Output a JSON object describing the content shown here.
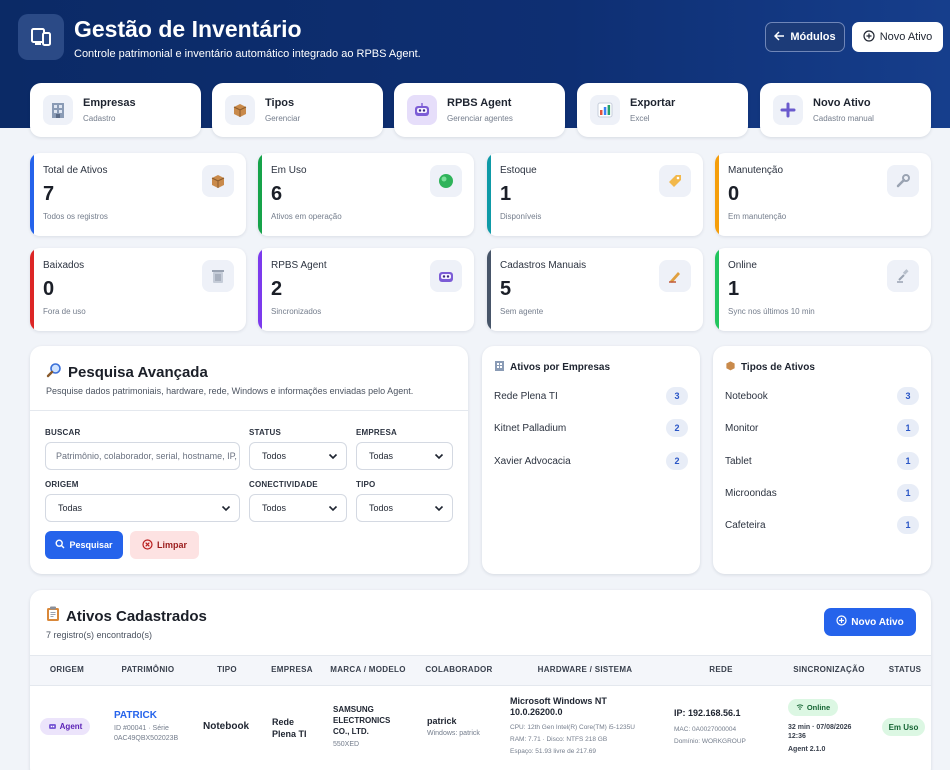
{
  "header": {
    "title": "Gestão de Inventário",
    "subtitle": "Controle patrimonial e inventário automático integrado ao RPBS Agent.",
    "modules_label": "Módulos",
    "new_asset_label": "Novo Ativo"
  },
  "quick_links": [
    {
      "title": "Empresas",
      "sub": "Cadastro",
      "icon": "building-icon"
    },
    {
      "title": "Tipos",
      "sub": "Gerenciar",
      "icon": "box-icon"
    },
    {
      "title": "RPBS Agent",
      "sub": "Gerenciar agentes",
      "icon": "robot-icon"
    },
    {
      "title": "Exportar",
      "sub": "Excel",
      "icon": "chart-icon"
    },
    {
      "title": "Novo Ativo",
      "sub": "Cadastro manual",
      "icon": "plus-icon"
    }
  ],
  "stats": [
    {
      "label": "Total de Ativos",
      "value": "7",
      "sub": "Todos os registros",
      "color": "#2563eb"
    },
    {
      "label": "Em Uso",
      "value": "6",
      "sub": "Ativos em operação",
      "color": "#16a34a"
    },
    {
      "label": "Estoque",
      "value": "1",
      "sub": "Disponíveis",
      "color": "#0e9aa7"
    },
    {
      "label": "Manutenção",
      "value": "0",
      "sub": "Em manutenção",
      "color": "#f59e0b"
    },
    {
      "label": "Baixados",
      "value": "0",
      "sub": "Fora de uso",
      "color": "#dc2626"
    },
    {
      "label": "RPBS Agent",
      "value": "2",
      "sub": "Sincronizados",
      "color": "#7c3aed"
    },
    {
      "label": "Cadastros Manuais",
      "value": "5",
      "sub": "Sem agente",
      "color": "#475569"
    },
    {
      "label": "Online",
      "value": "1",
      "sub": "Sync nos últimos 10 min",
      "color": "#22c55e"
    }
  ],
  "search": {
    "title": "Pesquisa Avançada",
    "description": "Pesquise dados patrimoniais, hardware, rede, Windows e informações enviadas pelo Agent.",
    "buscar_label": "BUSCAR",
    "buscar_placeholder": "Patrimônio, colaborador, serial, hostname, IP,",
    "status_label": "STATUS",
    "status_value": "Todos",
    "empresa_label": "EMPRESA",
    "empresa_value": "Todas",
    "origem_label": "ORIGEM",
    "origem_value": "Todas",
    "conectividade_label": "CONECTIVIDADE",
    "conectividade_value": "Todos",
    "tipo_label": "TIPO",
    "tipo_value": "Todos",
    "search_button": "Pesquisar",
    "clear_button": "Limpar"
  },
  "companies": {
    "title": "Ativos por Empresas",
    "items": [
      {
        "name": "Rede Plena TI",
        "count": "3"
      },
      {
        "name": "Kitnet Palladium",
        "count": "2"
      },
      {
        "name": "Xavier Advocacia",
        "count": "2"
      }
    ]
  },
  "types": {
    "title": "Tipos de Ativos",
    "items": [
      {
        "name": "Notebook",
        "count": "3"
      },
      {
        "name": "Monitor",
        "count": "1"
      },
      {
        "name": "Tablet",
        "count": "1"
      },
      {
        "name": "Microondas",
        "count": "1"
      },
      {
        "name": "Cafeteira",
        "count": "1"
      }
    ]
  },
  "assets": {
    "title": "Ativos Cadastrados",
    "count_text": "7 registro(s) encontrado(s)",
    "new_button": "Novo Ativo",
    "columns": [
      "ORIGEM",
      "PATRIMÔNIO",
      "TIPO",
      "EMPRESA",
      "MARCA / MODELO",
      "COLABORADOR",
      "HARDWARE / SISTEMA",
      "REDE",
      "SINCRONIZAÇÃO",
      "STATUS"
    ],
    "rows": [
      {
        "origem": "Agent",
        "patrimonio": "PATRICK",
        "patrimonio_id": "ID #00041 · Série",
        "patrimonio_serial": "0AC49QBX502023B",
        "tipo": "Notebook",
        "empresa_1": "Rede",
        "empresa_2": "Plena TI",
        "marca_1": "SAMSUNG",
        "marca_2": "ELECTRONICS",
        "marca_3": "CO., LTD.",
        "modelo": "550XED",
        "colaborador": "patrick",
        "colaborador_sub": "Windows: patrick",
        "os_1": "Microsoft Windows NT",
        "os_2": "10.0.26200.0",
        "cpu": "CPU: 12th Gen Intel(R) Core(TM) i5-1235U",
        "ram": "RAM: 7.71 · Disco: NTFS 218 GB",
        "espaco": "Espaço: 51.93 livre de 217.69",
        "ip": "IP: 192.168.56.1",
        "mac": "MAC: 0A0027000004",
        "dominio": "Domínio: WORKGROUP",
        "sync_state": "Online",
        "sync_time_1": "32 min · 07/08/2026",
        "sync_time_2": "12:36",
        "agent_version": "Agent 2.1.0",
        "status": "Em Uso"
      }
    ]
  }
}
